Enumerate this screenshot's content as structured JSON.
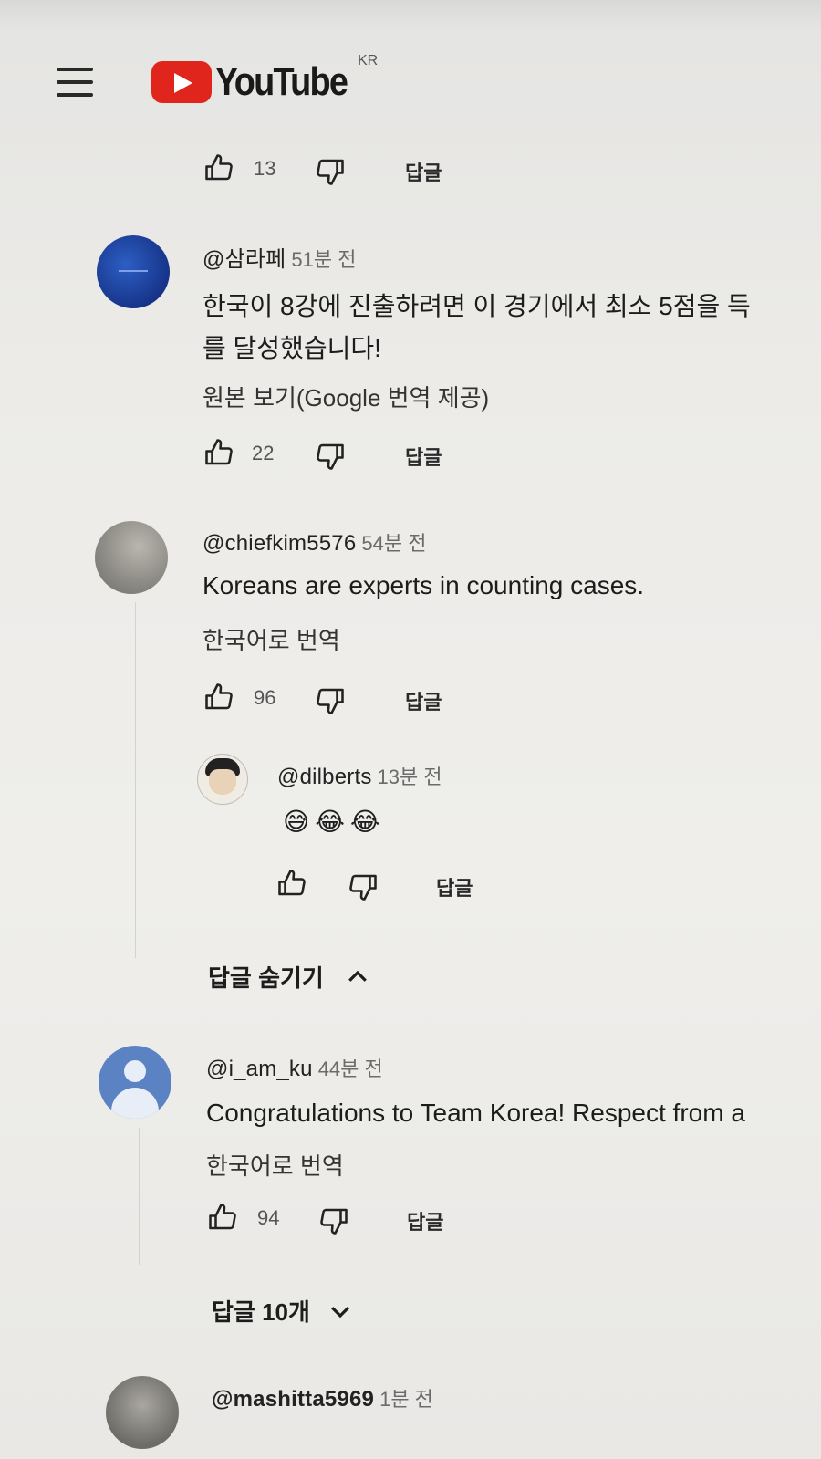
{
  "header": {
    "logo_text": "YouTube",
    "region": "KR"
  },
  "colors": {
    "brand_red": "#e0261c"
  },
  "top_actions": {
    "likes": "13",
    "reply": "답글"
  },
  "comments": [
    {
      "handle": "@삼라페",
      "time": "51분 전",
      "text_line1": "한국이 8강에 진출하려면 이 경기에서 최소 5점을 득",
      "text_line2": "를 달성했습니다!",
      "translate": "원본 보기(Google 번역 제공)",
      "likes": "22",
      "reply": "답글"
    },
    {
      "handle": "@chiefkim5576",
      "time": "54분 전",
      "text_line1": "Koreans are experts in counting cases.",
      "translate": "한국어로 번역",
      "likes": "96",
      "reply": "답글",
      "replies": [
        {
          "handle": "@dilberts",
          "time": "13분 전",
          "emoji": "😅😂😂",
          "reply": "답글"
        }
      ],
      "toggle_label": "답글 숨기기"
    },
    {
      "handle": "@i_am_ku",
      "time": "44분 전",
      "text_line1": "Congratulations to Team Korea! Respect from a",
      "translate": "한국어로 번역",
      "likes": "94",
      "reply": "답글",
      "toggle_label": "답글 10개"
    },
    {
      "handle": "@mashitta5969",
      "time": "1분 전"
    }
  ]
}
